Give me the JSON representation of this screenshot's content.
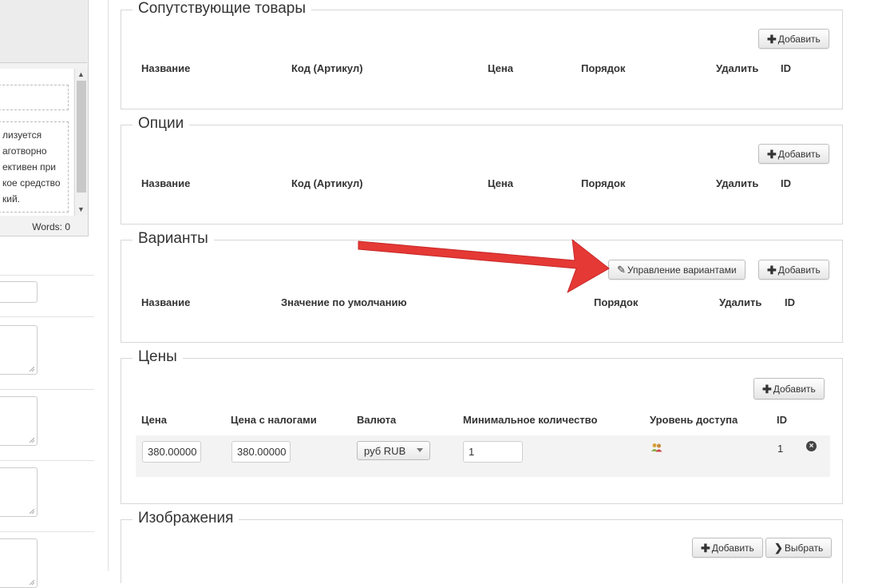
{
  "editor": {
    "lines": [
      "лизуется",
      "аготворно",
      "ективен при",
      "кое средство",
      "кий."
    ],
    "words_label": "Words: 0",
    "scroll_up": "▲",
    "scroll_down": "▼"
  },
  "related": {
    "title": "Сопутствующие товары",
    "add_label": "Добавить",
    "columns": [
      "Название",
      "Код (Артикул)",
      "Цена",
      "Порядок",
      "Удалить",
      "ID"
    ]
  },
  "options": {
    "title": "Опции",
    "add_label": "Добавить",
    "columns": [
      "Название",
      "Код (Артикул)",
      "Цена",
      "Порядок",
      "Удалить",
      "ID"
    ]
  },
  "variants": {
    "title": "Варианты",
    "manage_label": "Управление вариантами",
    "add_label": "Добавить",
    "columns": [
      "Название",
      "Значение по умолчанию",
      "Порядок",
      "Удалить",
      "ID"
    ]
  },
  "prices": {
    "title": "Цены",
    "add_label": "Добавить",
    "columns": [
      "Цена",
      "Цена с налогами",
      "Валюта",
      "Минимальное количество",
      "Уровень доступа",
      "ID"
    ],
    "row": {
      "price": "380.00000",
      "price_tax": "380.00000",
      "currency": "руб RUB",
      "min_qty": "1",
      "id": "1"
    }
  },
  "images": {
    "title": "Изображения",
    "add_label": "Добавить",
    "choose_label": "Выбрать"
  },
  "colors": {
    "arrow": "#e53935",
    "border": "#d7d7d7"
  }
}
